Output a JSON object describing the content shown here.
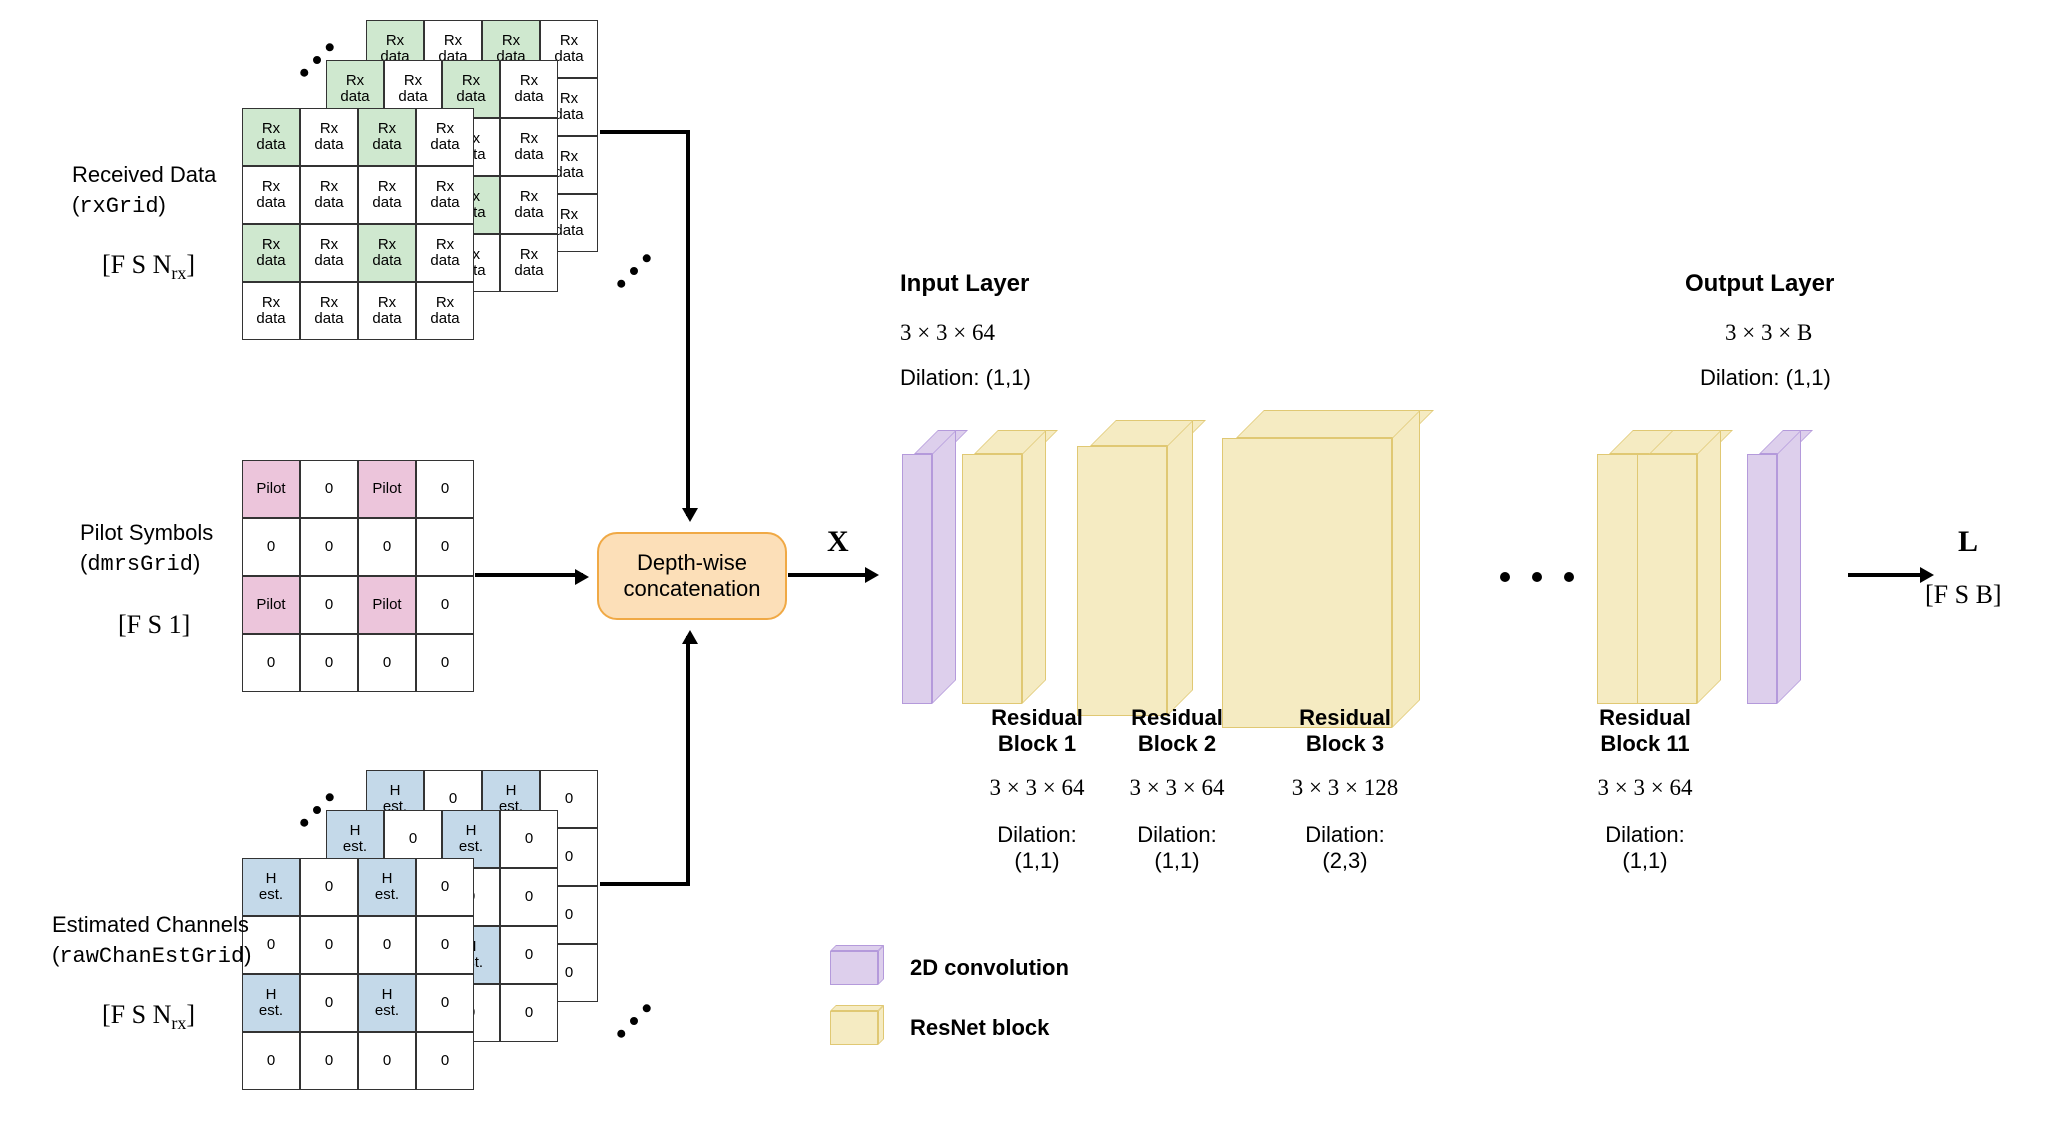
{
  "inputs": {
    "rx": {
      "title": "Received Data",
      "code": "rxGrid",
      "dims": "[F S N",
      "dimsSub": "rx",
      "cell": "Rx\ndata"
    },
    "pilot": {
      "title": "Pilot Symbols",
      "code": "dmrsGrid",
      "dims": "[F S 1]",
      "pilot": "Pilot",
      "zero": "0"
    },
    "chan": {
      "title": "Estimated Channels",
      "code": "rawChanEstGrid",
      "dims": "[F S N",
      "dimsSub": "rx",
      "h": "H\nest.",
      "zero": "0"
    }
  },
  "concat": "Depth-wise\nconcatenation",
  "X": "X",
  "L": "L",
  "outDims": "[F S B]",
  "layers": {
    "input": {
      "title": "Input Layer",
      "size": "3 × 3 × 64",
      "dil": "Dilation: (1,1)"
    },
    "r1": {
      "title": "Residual\nBlock 1",
      "size": "3 × 3 × 64",
      "dil": "Dilation:\n(1,1)"
    },
    "r2": {
      "title": "Residual\nBlock 2",
      "size": "3 × 3 × 64",
      "dil": "Dilation:\n(1,1)"
    },
    "r3": {
      "title": "Residual\nBlock 3",
      "size": "3 × 3 × 128",
      "dil": "Dilation:\n(2,3)"
    },
    "r11": {
      "title": "Residual\nBlock 11",
      "size": "3 × 3 × 64",
      "dil": "Dilation:\n(1,1)"
    },
    "output": {
      "title": "Output Layer",
      "size": "3 × 3 × B",
      "dil": "Dilation: (1,1)"
    }
  },
  "legend": {
    "conv": "2D convolution",
    "resnet": "ResNet block"
  },
  "chart_data": {
    "type": "table",
    "pipeline": [
      "rxGrid [F S N_rx]",
      "dmrsGrid [F S 1]",
      "rawChanEstGrid [F S N_rx]",
      "Depth-wise concatenation",
      "X",
      "Input Layer 3x3x64 dil(1,1)",
      "Residual Block 1 3x3x64 dil(1,1)",
      "Residual Block 2 3x3x64 dil(1,1)",
      "Residual Block 3 3x3x128 dil(2,3)",
      "...",
      "Residual Block 11 3x3x64 dil(1,1)",
      "Output Layer 3x3xB dil(1,1)",
      "L [F S B]"
    ],
    "legend": [
      "2D convolution",
      "ResNet block"
    ]
  }
}
